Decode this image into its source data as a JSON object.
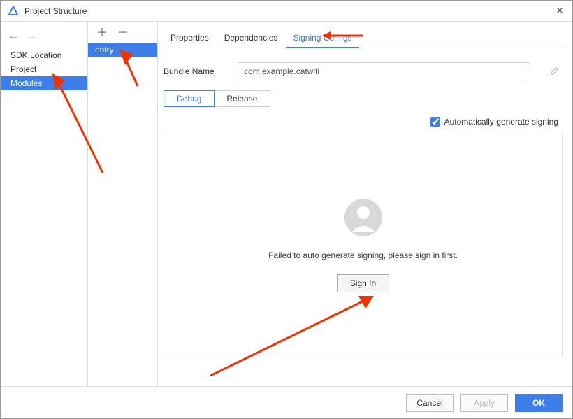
{
  "window": {
    "title": "Project Structure",
    "close": "✕"
  },
  "leftPane": {
    "items": [
      {
        "label": "SDK Location"
      },
      {
        "label": "Project"
      },
      {
        "label": "Modules",
        "selected": true
      }
    ]
  },
  "midPane": {
    "plus": "＋",
    "minus": "－",
    "items": [
      {
        "label": "entry",
        "selected": true
      }
    ]
  },
  "tabs": [
    {
      "label": "Properties"
    },
    {
      "label": "Dependencies"
    },
    {
      "label": "Signing Configs",
      "active": true
    }
  ],
  "bundle": {
    "label": "Bundle Name",
    "value": "com.example.catwifi"
  },
  "seg": [
    {
      "label": "Debug",
      "active": true
    },
    {
      "label": "Release"
    }
  ],
  "auto": {
    "label": "Automatically generate signing",
    "checked": true
  },
  "card": {
    "message": "Failed to auto generate signing, please sign in first.",
    "signInLabel": "Sign In"
  },
  "footer": {
    "cancel": "Cancel",
    "apply": "Apply",
    "ok": "OK"
  }
}
